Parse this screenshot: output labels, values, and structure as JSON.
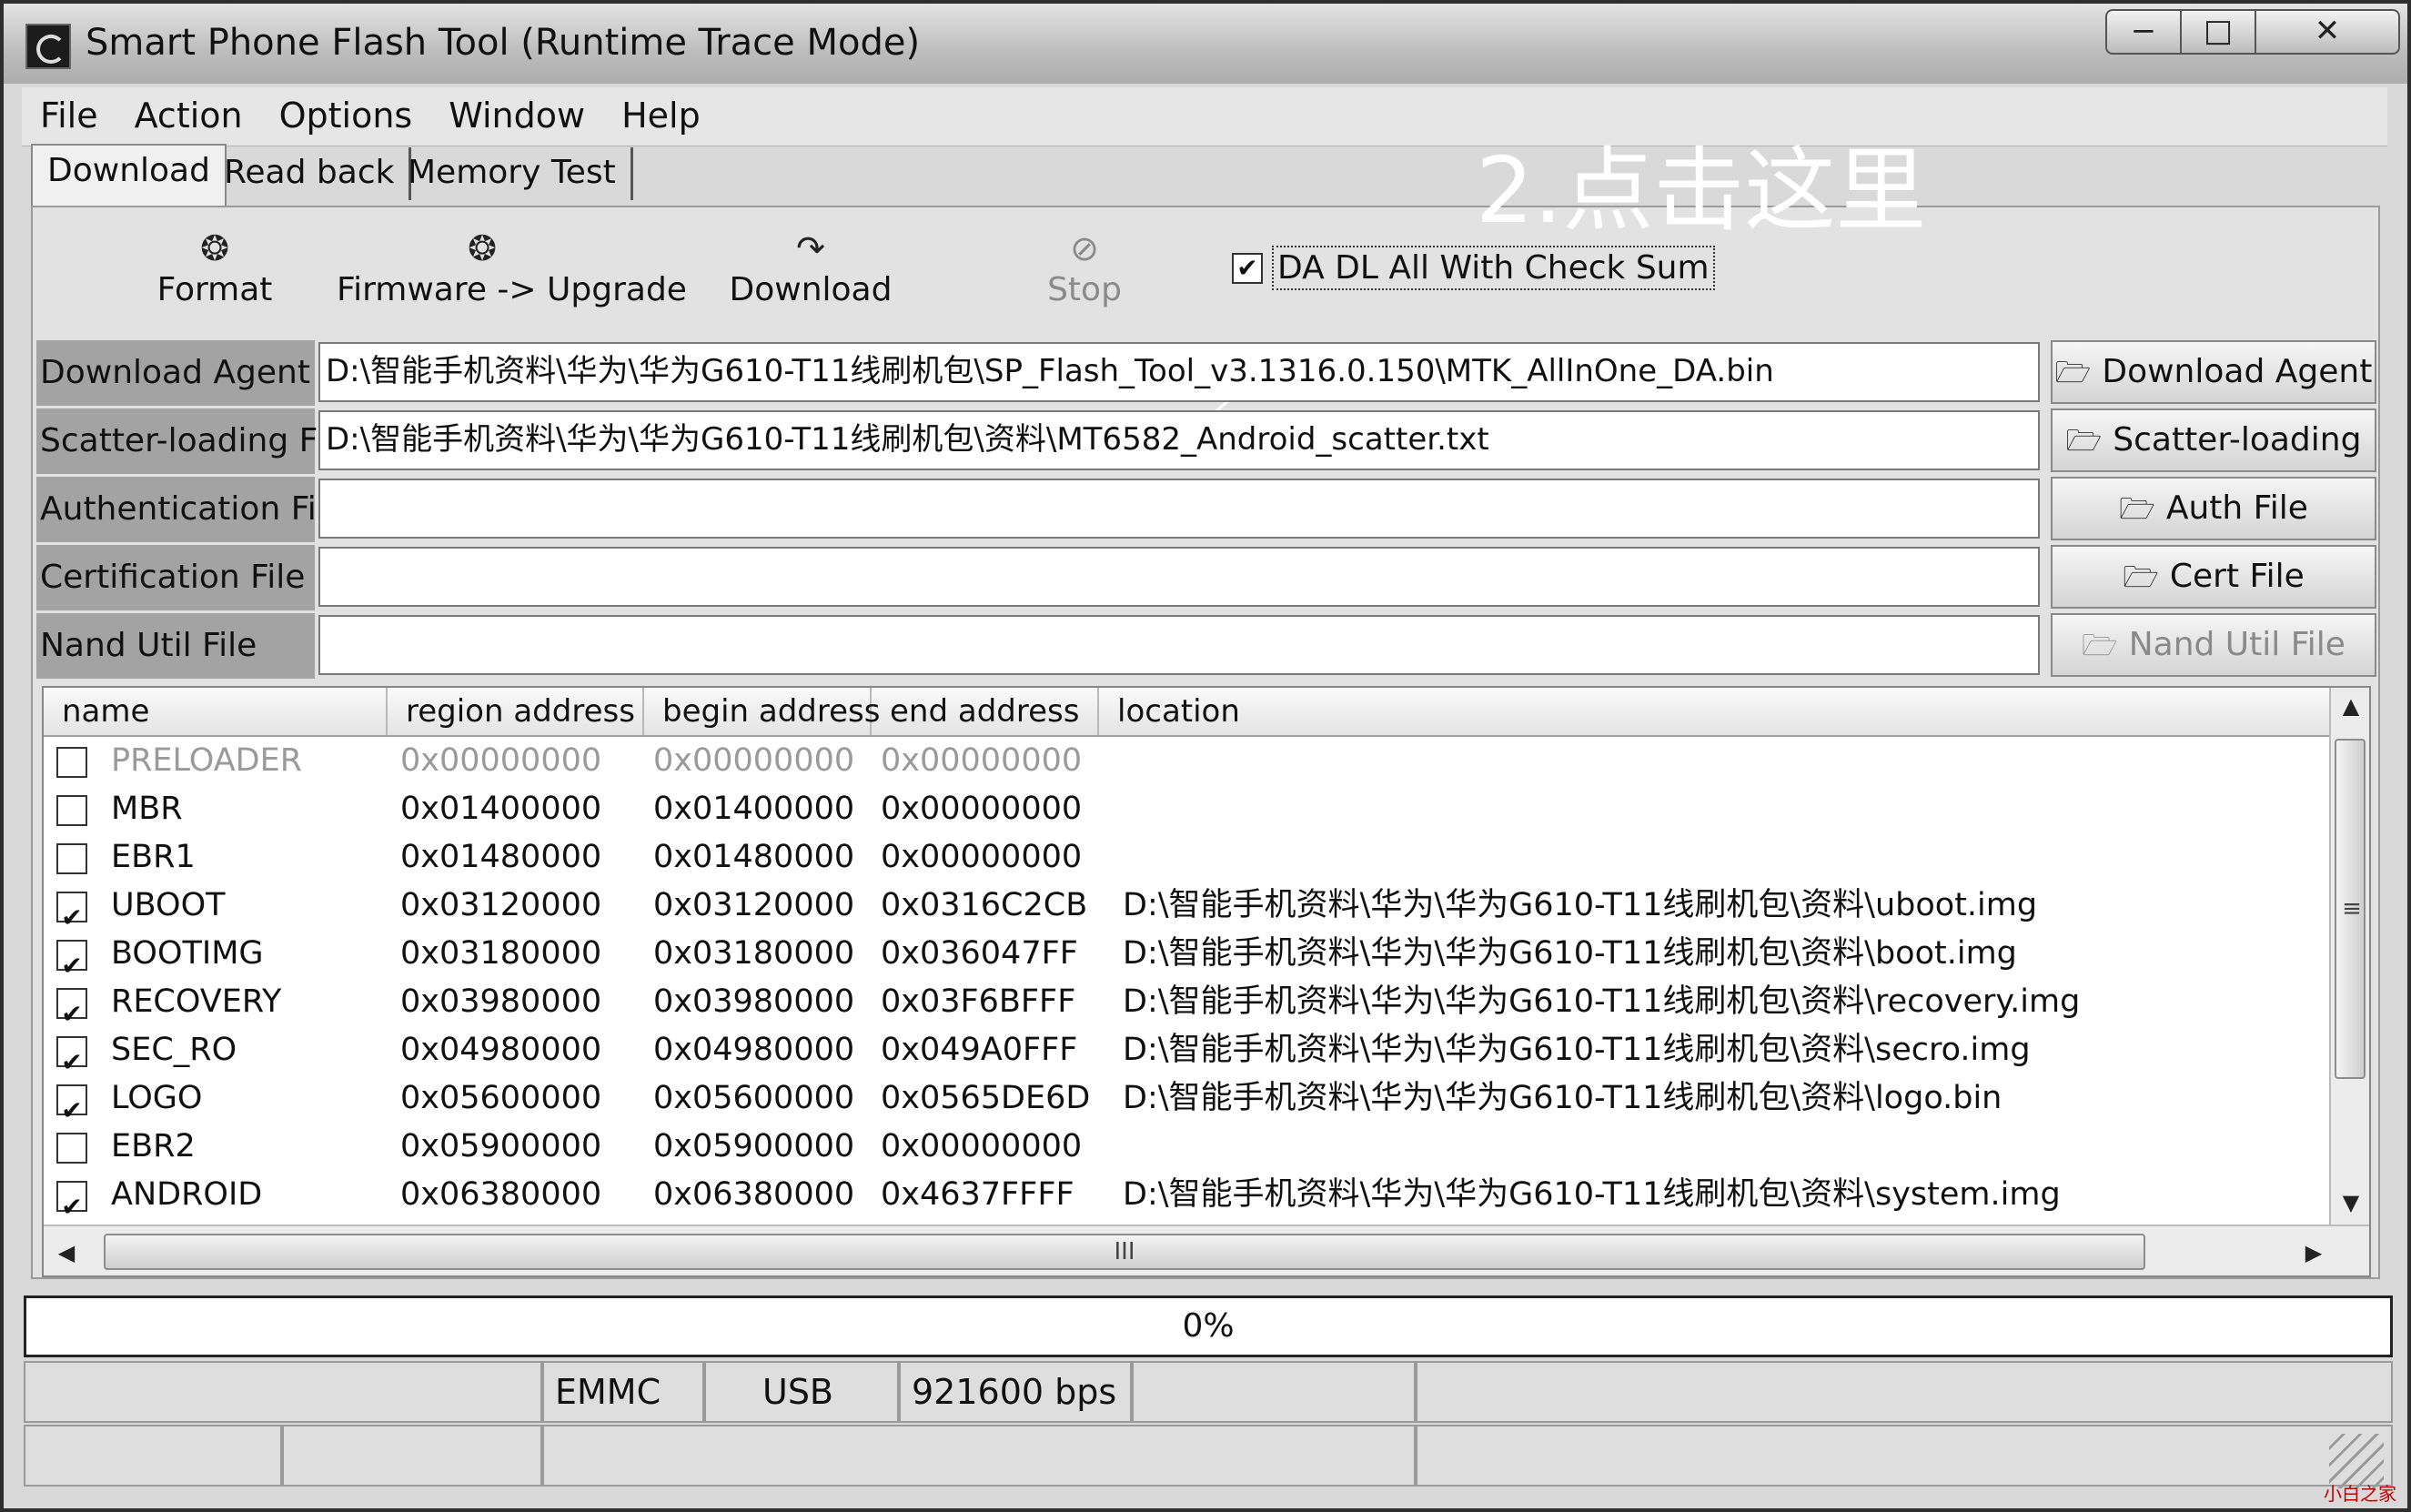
{
  "window": {
    "title": "Smart Phone Flash Tool (Runtime Trace Mode)",
    "controls": {
      "minimize": "−",
      "maximize": "□",
      "close": "✕"
    }
  },
  "menu": [
    "File",
    "Action",
    "Options",
    "Window",
    "Help"
  ],
  "tabs": [
    "Download",
    "Read back",
    "Memory Test"
  ],
  "toolbar": {
    "buttons": [
      {
        "label": "Format",
        "icon": "❂"
      },
      {
        "label": "Firmware -> Upgrade",
        "icon": "❂"
      },
      {
        "label": "Download",
        "icon": "↷"
      },
      {
        "label": "Stop",
        "icon": "⊘"
      }
    ],
    "checksum": {
      "label": "DA DL All With Check Sum",
      "checked": "✔"
    }
  },
  "annotation": {
    "text": "2.点击这里"
  },
  "files": {
    "folder_icon": "🗁",
    "rows": [
      {
        "label": "Download Agent",
        "value": "D:\\智能手机资料\\华为\\华为G610-T11线刷机包\\SP_Flash_Tool_v3.1316.0.150\\MTK_AllInOne_DA.bin",
        "button": "Download Agent"
      },
      {
        "label": "Scatter-loading File",
        "value": "D:\\智能手机资料\\华为\\华为G610-T11线刷机包\\资料\\MT6582_Android_scatter.txt",
        "button": "Scatter-loading"
      },
      {
        "label": "Authentication File",
        "value": "",
        "button": "Auth File"
      },
      {
        "label": "Certification File",
        "value": "",
        "button": "Cert File"
      },
      {
        "label": "Nand Util File",
        "value": "",
        "button": "Nand Util File"
      }
    ]
  },
  "table": {
    "columns": [
      "name",
      "region address",
      "begin address",
      "end address",
      "location"
    ],
    "check_mark": "✔",
    "rows": [
      {
        "checked": false,
        "name": "PRELOADER",
        "region": "0x00000000",
        "begin": "0x00000000",
        "end": "0x00000000",
        "location": ""
      },
      {
        "checked": false,
        "name": "MBR",
        "region": "0x01400000",
        "begin": "0x01400000",
        "end": "0x00000000",
        "location": ""
      },
      {
        "checked": false,
        "name": "EBR1",
        "region": "0x01480000",
        "begin": "0x01480000",
        "end": "0x00000000",
        "location": ""
      },
      {
        "checked": true,
        "name": "UBOOT",
        "region": "0x03120000",
        "begin": "0x03120000",
        "end": "0x0316C2CB",
        "location": "D:\\智能手机资料\\华为\\华为G610-T11线刷机包\\资料\\uboot.img"
      },
      {
        "checked": true,
        "name": "BOOTIMG",
        "region": "0x03180000",
        "begin": "0x03180000",
        "end": "0x036047FF",
        "location": "D:\\智能手机资料\\华为\\华为G610-T11线刷机包\\资料\\boot.img"
      },
      {
        "checked": true,
        "name": "RECOVERY",
        "region": "0x03980000",
        "begin": "0x03980000",
        "end": "0x03F6BFFF",
        "location": "D:\\智能手机资料\\华为\\华为G610-T11线刷机包\\资料\\recovery.img"
      },
      {
        "checked": true,
        "name": "SEC_RO",
        "region": "0x04980000",
        "begin": "0x04980000",
        "end": "0x049A0FFF",
        "location": "D:\\智能手机资料\\华为\\华为G610-T11线刷机包\\资料\\secro.img"
      },
      {
        "checked": true,
        "name": "LOGO",
        "region": "0x05600000",
        "begin": "0x05600000",
        "end": "0x0565DE6D",
        "location": "D:\\智能手机资料\\华为\\华为G610-T11线刷机包\\资料\\logo.bin"
      },
      {
        "checked": false,
        "name": "EBR2",
        "region": "0x05900000",
        "begin": "0x05900000",
        "end": "0x00000000",
        "location": ""
      },
      {
        "checked": true,
        "name": "ANDROID",
        "region": "0x06380000",
        "begin": "0x06380000",
        "end": "0x4637FFFF",
        "location": "D:\\智能手机资料\\华为\\华为G610-T11线刷机包\\资料\\system.img"
      }
    ]
  },
  "scrollbar": {
    "up": "▲",
    "down": "▼",
    "left": "◀",
    "right": "▶",
    "grip_v": "≡",
    "grip_h": "III"
  },
  "progress": {
    "value": 0,
    "label": "0%"
  },
  "status": {
    "storage": "EMMC",
    "port": "USB",
    "baud": "921600 bps"
  },
  "watermark": "小白之家"
}
